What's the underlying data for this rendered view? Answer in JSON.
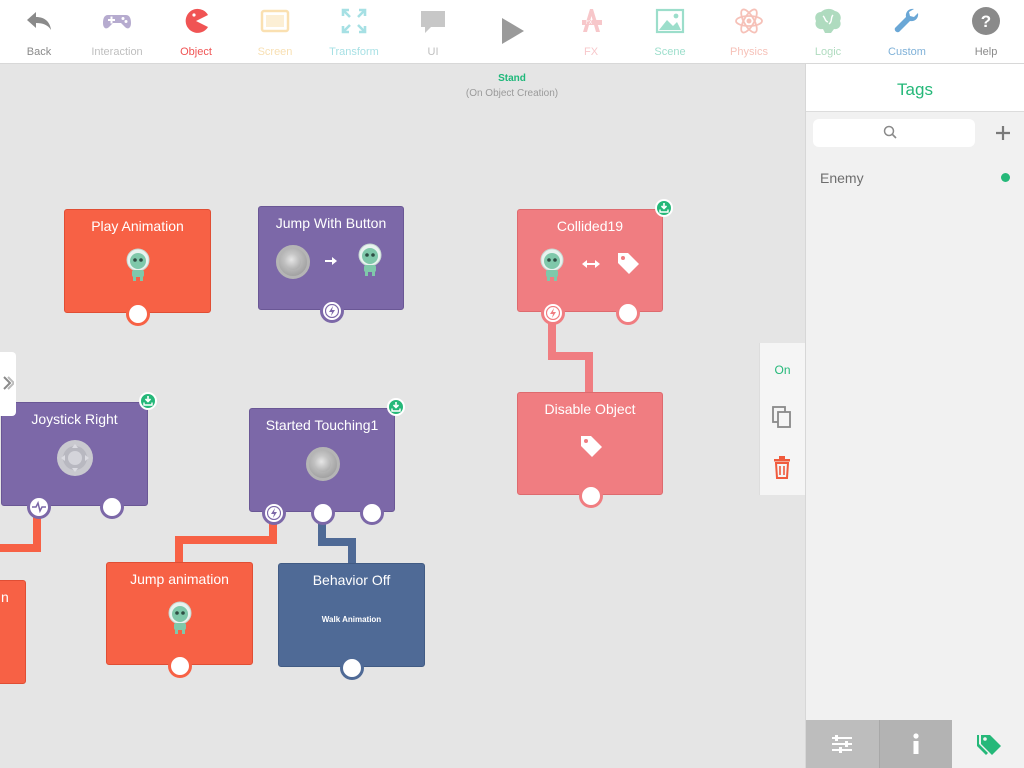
{
  "toolbar": {
    "items": [
      {
        "label": "Back",
        "icon": "back-arrow-icon"
      },
      {
        "label": "Interaction",
        "icon": "gamepad-icon"
      },
      {
        "label": "Object",
        "icon": "pacman-icon"
      },
      {
        "label": "Screen",
        "icon": "screen-icon"
      },
      {
        "label": "Transform",
        "icon": "transform-icon"
      },
      {
        "label": "UI",
        "icon": "speech-bubble-icon"
      },
      {
        "label": "",
        "icon": "play-icon"
      },
      {
        "label": "FX",
        "icon": "fx-icon"
      },
      {
        "label": "Scene",
        "icon": "landscape-icon"
      },
      {
        "label": "Physics",
        "icon": "atom-icon"
      },
      {
        "label": "Logic",
        "icon": "brain-icon"
      },
      {
        "label": "Custom",
        "icon": "wrench-icon"
      },
      {
        "label": "Help",
        "icon": "help-icon"
      }
    ]
  },
  "canvas": {
    "scene_title": "Stand",
    "scene_subtitle": "(On Object Creation)",
    "blocks": {
      "play_animation": "Play Animation",
      "jump_with_button": "Jump With Button",
      "collided": "Collided19",
      "joystick_right": "Joystick Right",
      "started_touching": "Started Touching1",
      "disable_object": "Disable Object",
      "jump_animation": "Jump animation",
      "behavior_off": "Behavior Off",
      "behavior_off_target": "Walk Animation",
      "partial_block": "n"
    },
    "mini_bar": {
      "on_label": "On"
    }
  },
  "panel": {
    "title": "Tags",
    "search_placeholder": "",
    "tags": [
      {
        "name": "Enemy",
        "active": true
      }
    ]
  },
  "colors": {
    "accent_green": "#25b879",
    "object_red": "#f76145",
    "interaction_purple": "#7c68a8",
    "tag_pink": "#f07d81",
    "behavior_navy": "#4f6a96"
  }
}
